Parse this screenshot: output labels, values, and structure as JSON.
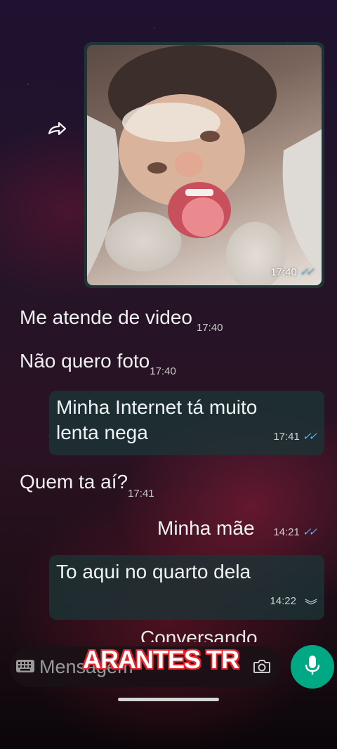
{
  "chat": {
    "photo_message": {
      "time": "17:40",
      "ticks": "✓✓"
    },
    "messages": [
      {
        "text": "Me atende de video",
        "time": "17:40"
      },
      {
        "text": "Não quero foto",
        "time": "17:40"
      },
      {
        "text_line1": "Minha Internet tá muito",
        "text_line2": "lenta nega",
        "time": "17:41",
        "ticks": "✓✓"
      },
      {
        "text": "Quem ta aí?",
        "time": "17:41"
      },
      {
        "text": "Minha mãe",
        "time": "14:21",
        "ticks": "✓✓"
      },
      {
        "text": "To aqui no quarto dela",
        "time": "14:22"
      },
      {
        "text": "Conversando"
      }
    ],
    "scroll_down_glyph": "︾"
  },
  "input": {
    "placeholder": "Mensagem"
  },
  "watermark": "ARANTES TR",
  "colors": {
    "outgoing_bubble": "#1b3436",
    "mic_button": "#00a884",
    "read_ticks": "#53bdeb",
    "watermark_outline": "#e6242b"
  },
  "icons": [
    "forward-icon",
    "keyboard-icon",
    "camera-icon",
    "mic-icon",
    "double-check-icon",
    "chevron-down-icon"
  ]
}
